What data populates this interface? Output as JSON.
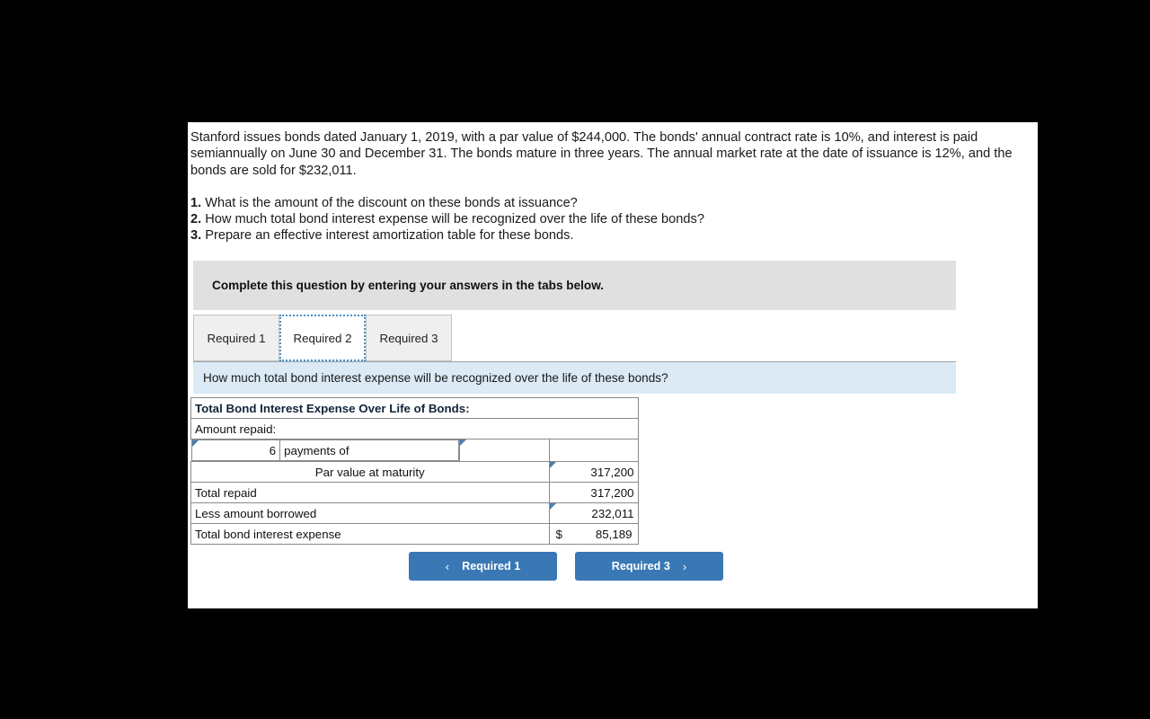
{
  "problem": {
    "paragraph": "Stanford issues bonds dated January 1, 2019, with a par value of $244,000. The bonds' annual contract rate is 10%, and interest is paid semiannually on June 30 and December 31. The bonds mature in three years. The annual market rate at the date of issuance is 12%, and the bonds are sold for $232,011.",
    "questions": [
      {
        "num": "1.",
        "text": "What is the amount of the discount on these bonds at issuance?"
      },
      {
        "num": "2.",
        "text": "How much total bond interest expense will be recognized over the life of these bonds?"
      },
      {
        "num": "3.",
        "text": "Prepare an effective interest amortization table for these bonds."
      }
    ]
  },
  "banner": {
    "text": "Complete this question by entering your answers in the tabs below."
  },
  "tabs": [
    {
      "label": "Required 1",
      "active": false
    },
    {
      "label": "Required 2",
      "active": true
    },
    {
      "label": "Required 3",
      "active": false
    }
  ],
  "question_bar": {
    "text": "How much total bond interest expense will be recognized over the life of these bonds?"
  },
  "table": {
    "header": "Total Bond Interest Expense Over Life of Bonds:",
    "subheader": "Amount repaid:",
    "payments_row": {
      "count": "6",
      "label": "payments of",
      "amount": ""
    },
    "rows": [
      {
        "label": "Par value at maturity",
        "value": "317,200",
        "align": "center",
        "input": true
      },
      {
        "label": "Total repaid",
        "value": "317,200",
        "align": "left",
        "input": false
      },
      {
        "label": "Less amount borrowed",
        "value": "232,011",
        "align": "left",
        "input": true
      }
    ],
    "total_row": {
      "label": "Total bond interest expense",
      "currency": "$",
      "value": "85,189"
    }
  },
  "nav": {
    "prev_label": "Required 1",
    "next_label": "Required 3",
    "prev_icon": "chevron-left",
    "next_icon": "chevron-right",
    "prev_glyph": "‹",
    "next_glyph": "›"
  },
  "colors": {
    "table_header_blue": "#7cabd8",
    "input_border_blue": "#4a7fb0",
    "total_yellow": "#ffffcc",
    "banner_gray": "#e0e0e0",
    "question_bar_blue": "#dbeaf5",
    "button_blue": "#3a78b5"
  }
}
